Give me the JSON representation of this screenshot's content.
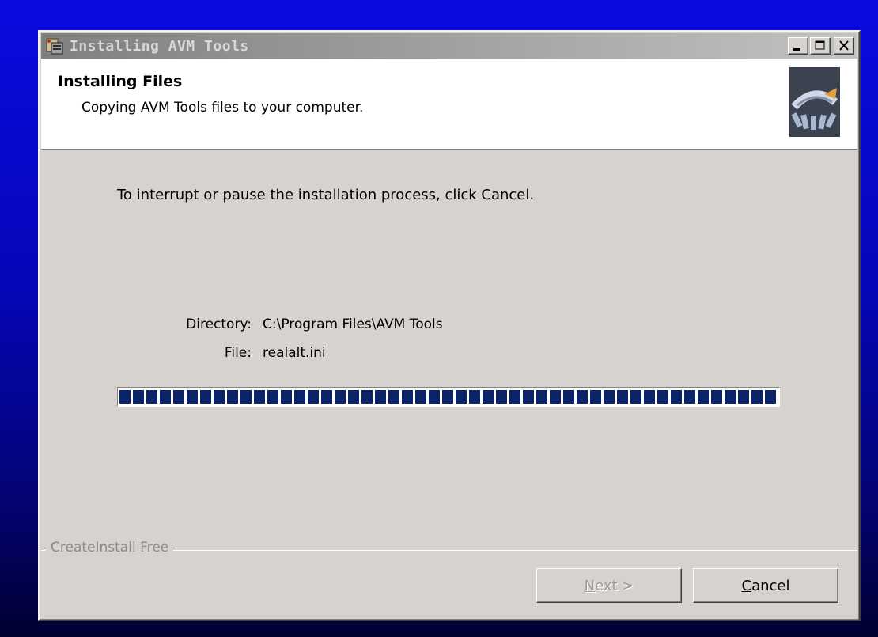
{
  "window": {
    "title": "Installing AVM Tools"
  },
  "header": {
    "title": "Installing Files",
    "subtitle": "Copying AVM Tools files to your computer."
  },
  "body": {
    "instruction": "To interrupt or pause the installation process, click Cancel.",
    "directory_label": "Directory:",
    "directory_value": "C:\\Program Files\\AVM Tools",
    "file_label": "File:",
    "file_value": "realalt.ini",
    "progress_percent": 100
  },
  "footer": {
    "brand": "CreateInstall Free",
    "next_label_mnemonic": "N",
    "next_label_rest": "ext >",
    "cancel_label_mnemonic": "C",
    "cancel_label_rest": "ancel"
  },
  "icons": {
    "app": "installer-icon",
    "header": "install-graphic-icon"
  },
  "colors": {
    "progress": "#0a246a",
    "titlebar_inactive": "#808080",
    "dialog": "#d6d3ce"
  }
}
